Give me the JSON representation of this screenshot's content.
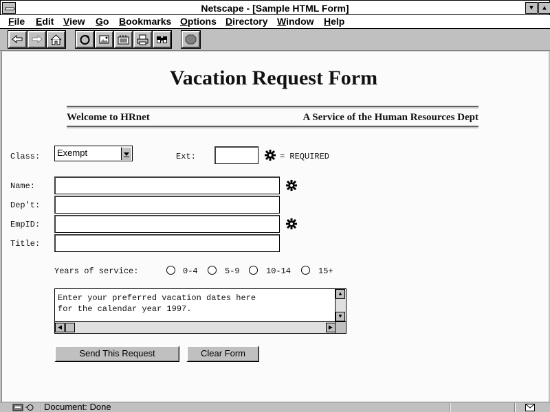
{
  "window": {
    "title": "Netscape - [Sample HTML Form]",
    "min_glyph": "▼",
    "max_glyph": "▲"
  },
  "menu": [
    "File",
    "Edit",
    "View",
    "Go",
    "Bookmarks",
    "Options",
    "Directory",
    "Window",
    "Help"
  ],
  "toolbar": {
    "icons": [
      "back-icon",
      "forward-icon",
      "home-icon",
      "reload-icon",
      "images-icon",
      "open-icon",
      "print-icon",
      "find-icon",
      "stop-icon"
    ]
  },
  "page": {
    "title": "Vacation Request Form",
    "welcome": "Welcome to HRnet",
    "service": "A Service of the Human Resources Dept"
  },
  "form": {
    "class_label": "Class:",
    "class_value": "Exempt",
    "ext_label": "Ext:",
    "ext_value": "",
    "required_note": "= REQUIRED",
    "name_label": "Name:",
    "dept_label": "Dep't:",
    "empid_label": "EmpID:",
    "title_label": "Title:",
    "name_value": "",
    "dept_value": "",
    "empid_value": "",
    "title_value": "",
    "years_label": "Years of service:",
    "years_options": [
      "0-4",
      "5-9",
      "10-14",
      "15+"
    ],
    "years_selected": null,
    "textarea_value": "Enter your preferred vacation dates here\nfor the calendar year 1997.",
    "submit_label": "Send This Request",
    "clear_label": "Clear Form"
  },
  "status": {
    "text": "Document: Done"
  },
  "colors": {
    "window_gray": "#c0c0c0",
    "page_bg": "#fbfbfb"
  }
}
